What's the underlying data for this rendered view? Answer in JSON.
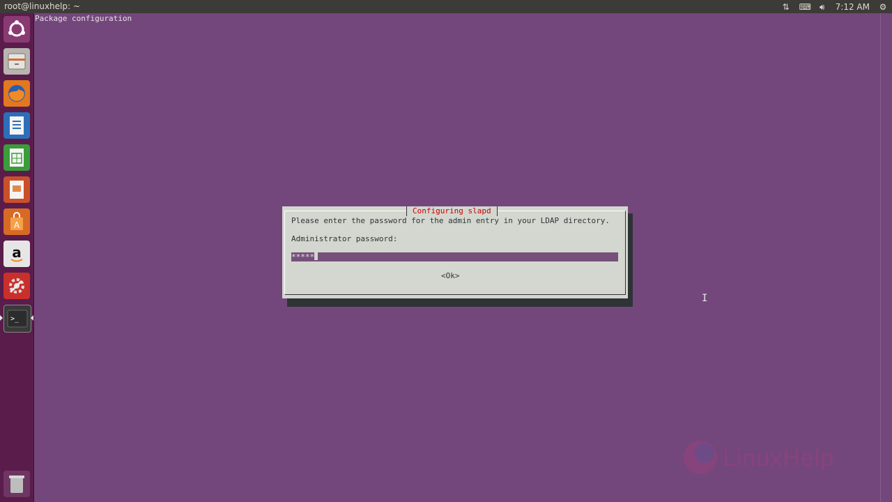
{
  "topbar": {
    "window_title": "root@linuxhelp: ~",
    "time": "7:12 AM",
    "icons": [
      "network-icon",
      "keyboard-icon",
      "volume-icon",
      "settings-icon"
    ]
  },
  "launcher": {
    "items": [
      {
        "name": "ubuntu-dash",
        "icon": "ubuntu-logo-icon"
      },
      {
        "name": "files",
        "icon": "file-cabinet-icon"
      },
      {
        "name": "firefox",
        "icon": "firefox-icon"
      },
      {
        "name": "writer",
        "icon": "document-icon"
      },
      {
        "name": "calc",
        "icon": "spreadsheet-icon"
      },
      {
        "name": "impress",
        "icon": "presentation-icon"
      },
      {
        "name": "software-center",
        "icon": "shopping-bag-icon"
      },
      {
        "name": "amazon",
        "icon": "amazon-icon"
      },
      {
        "name": "system-settings",
        "icon": "wrench-gear-icon"
      },
      {
        "name": "terminal",
        "icon": "terminal-icon"
      },
      {
        "name": "trash",
        "icon": "trash-icon"
      }
    ]
  },
  "terminal": {
    "header": "Package configuration"
  },
  "dialog": {
    "title": "Configuring slapd",
    "prompt": "Please enter the password for the admin entry in your LDAP directory.",
    "label": "Administrator password:",
    "password_mask": "*****",
    "ok_label": "<Ok>"
  },
  "watermark": {
    "text": "LinuxHelp"
  },
  "colors": {
    "terminal_bg": "#74477c",
    "dialog_bg": "#d3d7cf",
    "dialog_title": "#cc0000",
    "launcher_bg": "#5a1c4b",
    "topbar_bg": "#3c3b37"
  }
}
